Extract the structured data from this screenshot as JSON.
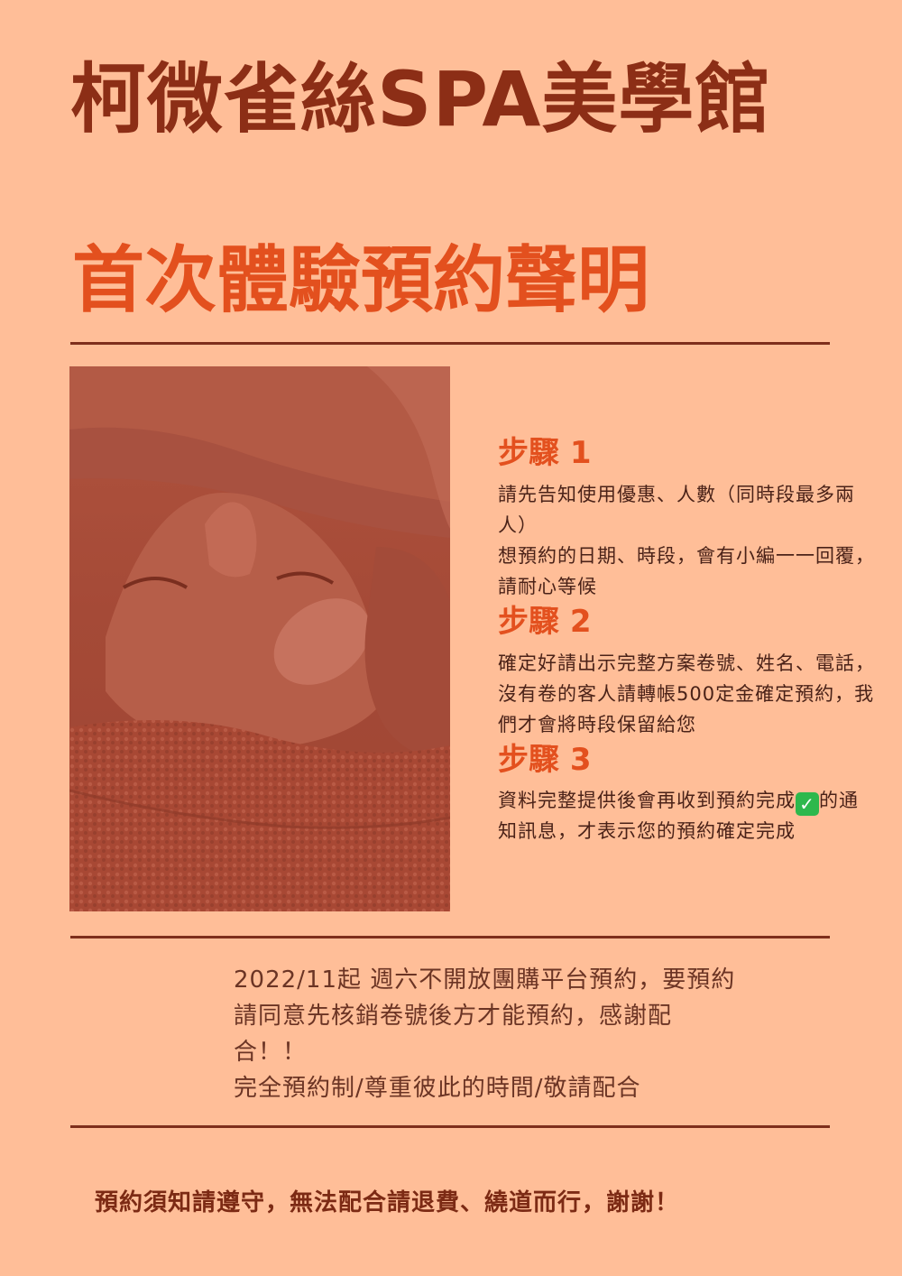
{
  "header": {
    "shop_name": "柯微雀絲SPA美學館",
    "notice_title": "首次體驗預約聲明"
  },
  "photo": {
    "icon": "facial-massage-photo"
  },
  "steps": [
    {
      "title": "步驟 1",
      "body": "請先告知使用優惠、人數（同時段最多兩人）\n想預約的日期、時段，會有小編一一回覆，請耐心等候"
    },
    {
      "title": "步驟 2",
      "body": "確定好請出示完整方案卷號、姓名、電話，沒有卷的客人請轉帳500定金確定預約，我們才會將時段保留給您"
    },
    {
      "title": "步驟 3",
      "body_before_icon": "資料完整提供後會再收到預約完成",
      "icon": "check-mark-icon",
      "body_after_icon": "的通知訊息，才表示您的預約確定完成"
    }
  ],
  "policy": {
    "text": "2022/11起 週六不開放團購平台預約，要預約請同意先核銷卷號後方才能預約，感謝配合！！\n完全預約制/尊重彼此的時間/敬請配合"
  },
  "footer": {
    "note": "預約須知請遵守，無法配合請退費、繞道而行，謝謝！"
  },
  "colors": {
    "background": "#FFBE98",
    "heading_dark": "#8C2E16",
    "heading_accent": "#E3501E",
    "rule": "#7E2F1C",
    "body_text": "#4A2218"
  }
}
